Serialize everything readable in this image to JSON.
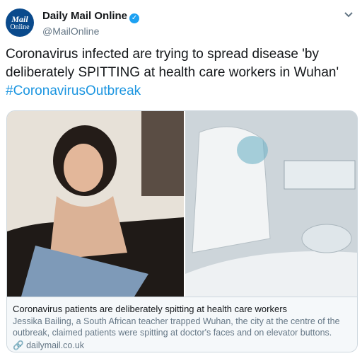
{
  "account": {
    "avatar_line1": "Mail",
    "avatar_line2": "Online",
    "display_name": "Daily Mail Online",
    "handle": "@MailOnline"
  },
  "tweet": {
    "text": "Coronavirus infected are trying to spread disease 'by deliberately SPITTING at health care workers in Wuhan'",
    "hashtag": "#CoronavirusOutbreak"
  },
  "card": {
    "title": "Coronavirus patients are deliberately spitting at health care workers",
    "description": "Jessika Bailing, a South African teacher trapped Wuhan, the city at the centre of the outbreak, claimed patients were spitting at doctor's faces and on elevator buttons.",
    "domain": "dailymail.co.uk"
  },
  "colors": {
    "brand_blue": "#0a4a8c",
    "verified": "#1da1f2",
    "link": "#1b95e0"
  }
}
